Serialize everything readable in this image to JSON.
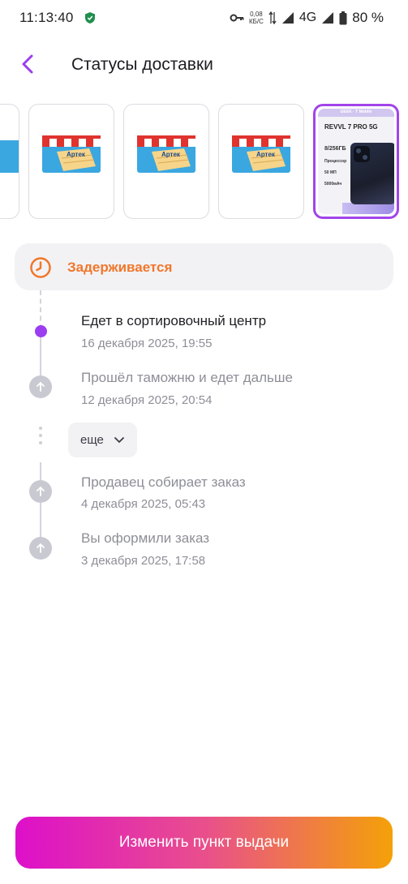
{
  "status_bar": {
    "time": "11:13:40",
    "speed_value": "0,08",
    "speed_unit": "КБ/С",
    "network": "4G",
    "battery": "80 %",
    "icons": [
      "shield-icon",
      "key-icon",
      "data-arrows-icon",
      "signal-icon",
      "battery-icon"
    ]
  },
  "header": {
    "title": "Статусы доставки",
    "back_icon": "chevron-left-icon",
    "accent_color": "#9b3df0"
  },
  "products": {
    "items": [
      {
        "name": "Артек"
      },
      {
        "name": "Артек"
      },
      {
        "name": "Артек"
      },
      {
        "name": "Артек"
      },
      {
        "brand": "GEEK · T Mobile",
        "title": "REVVL 7 PRO 5G",
        "memory": "8/256ГБ",
        "specs": [
          "Процессор",
          "50 МП",
          "5000мАч"
        ],
        "selected": true
      }
    ]
  },
  "banner": {
    "text": "Задерживается",
    "icon": "clock-icon",
    "color": "#f0772b"
  },
  "timeline": {
    "items": [
      {
        "title": "Едет в сортировочный центр",
        "date": "16 декабря 2025, 19:55",
        "current": true
      },
      {
        "title": "Прошёл таможню и едет дальше",
        "date": "12 декабря 2025, 20:54",
        "current": false
      },
      {
        "title": "Продавец собирает заказ",
        "date": "4 декабря 2025, 05:43",
        "current": false
      },
      {
        "title": "Вы оформили заказ",
        "date": "3 декабря 2025, 17:58",
        "current": false
      }
    ],
    "more_label": "еще"
  },
  "footer": {
    "button_label": "Изменить пункт выдачи"
  }
}
